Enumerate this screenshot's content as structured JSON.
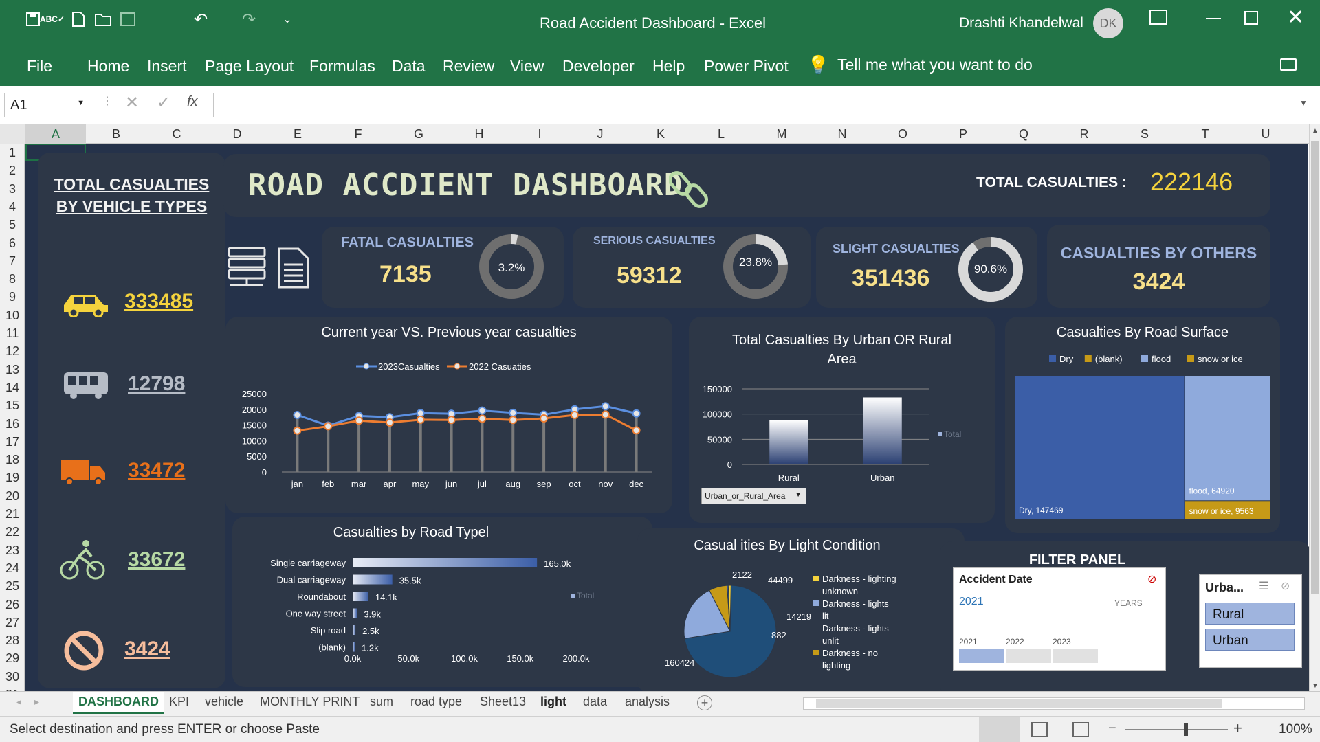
{
  "window": {
    "title": "Road Accident Dashboard  -  Excel",
    "user": "Drashti Khandelwal",
    "user_initials": "DK"
  },
  "menu": [
    "File",
    "Home",
    "Insert",
    "Page Layout",
    "Formulas",
    "Data",
    "Review",
    "View",
    "Developer",
    "Help",
    "Power Pivot"
  ],
  "tell_me": "Tell me what you want to do",
  "formula_bar": {
    "cell_ref": "A1",
    "fx": "fx",
    "value": ""
  },
  "columns": [
    "A",
    "B",
    "C",
    "D",
    "E",
    "F",
    "G",
    "H",
    "I",
    "J",
    "K",
    "L",
    "M",
    "N",
    "O",
    "P",
    "Q",
    "R",
    "S",
    "T",
    "U"
  ],
  "rows": [
    "1",
    "2",
    "3",
    "4",
    "5",
    "6",
    "7",
    "8",
    "9",
    "10",
    "11",
    "12",
    "13",
    "14",
    "15",
    "16",
    "17",
    "18",
    "19",
    "20",
    "21",
    "22",
    "23",
    "24",
    "25",
    "26",
    "27",
    "28",
    "29",
    "30",
    "31"
  ],
  "dashboard": {
    "title": "ROAD ACCDIENT DASHBOARD",
    "total_label": "TOTAL CASUALTIES :",
    "total_value": "222146",
    "vehicle_panel_title": "TOTAL CASUALTIES BY VEHICLE TYPES",
    "vehicles": [
      {
        "icon": "car-icon",
        "value": "333485",
        "color": "#f5d33d"
      },
      {
        "icon": "bus-icon",
        "value": "12798",
        "color": "#b6bcc6"
      },
      {
        "icon": "truck-icon",
        "value": "33472",
        "color": "#e8701a"
      },
      {
        "icon": "bicycle-icon",
        "value": "33672",
        "color": "#b7d9a4"
      },
      {
        "icon": "no-entry-icon",
        "value": "3424",
        "color": "#f6bd9c"
      }
    ],
    "kpis": [
      {
        "label": "FATAL CASUALTIES",
        "value": "7135",
        "pct": "3.2%",
        "frac": 0.032
      },
      {
        "label": "SERIOUS  CASUALTIES",
        "value": "59312",
        "pct": "23.8%",
        "frac": 0.238
      },
      {
        "label": "SLIGHT CASUALTIES",
        "value": "351436",
        "pct": "90.6%",
        "frac": 0.906
      }
    ],
    "others": {
      "label": "CASUALTIES BY OTHERS",
      "value": "3424"
    },
    "filter_panel": {
      "title": "FILTER PANEL",
      "timeline": {
        "title": "Accident Date",
        "year": "2021",
        "period": "YEARS",
        "years": [
          "2021",
          "2022",
          "2023"
        ]
      },
      "slicer": {
        "title": "Urba...",
        "items": [
          "Rural",
          "Urban"
        ]
      }
    }
  },
  "chart_data": [
    {
      "type": "line",
      "title": "Current year VS.  Previous year casualties",
      "categories": [
        "jan",
        "feb",
        "mar",
        "apr",
        "may",
        "jun",
        "jul",
        "aug",
        "sep",
        "oct",
        "nov",
        "dec"
      ],
      "series": [
        {
          "name": "2023Casualties",
          "color": "#5b8fe0",
          "values": [
            18200,
            14800,
            17900,
            17500,
            18800,
            18600,
            19600,
            18900,
            18300,
            20000,
            21000,
            18700
          ]
        },
        {
          "name": "2022 Casuaties",
          "color": "#ed7d31",
          "values": [
            13200,
            14600,
            16400,
            15800,
            16700,
            16600,
            17000,
            16600,
            17100,
            18200,
            18300,
            13300
          ]
        }
      ],
      "yticks": [
        "0",
        "5000",
        "10000",
        "15000",
        "20000",
        "25000"
      ],
      "ylim": [
        0,
        25000
      ],
      "grid": false
    },
    {
      "type": "bar",
      "title": "Total Casualties By Urban OR Rural Area",
      "categories": [
        "Rural",
        "Urban"
      ],
      "values": [
        88000,
        133000
      ],
      "yticks": [
        "0",
        "50000",
        "100000",
        "150000"
      ],
      "ylim": [
        0,
        150000
      ],
      "legend": "Total",
      "filter": "Urban_or_Rural_Area"
    },
    {
      "type": "treemap",
      "title": "Casualties By Road Surface",
      "legend": [
        {
          "name": "Dry",
          "color": "#3b5ea7"
        },
        {
          "name": "(blank)",
          "color": "#c69a17"
        },
        {
          "name": "flood",
          "color": "#8faadc"
        },
        {
          "name": "snow or ice",
          "color": "#c69a17"
        }
      ],
      "items": [
        {
          "label": "Dry, 147469",
          "value": 147469
        },
        {
          "label": "flood, 64920",
          "value": 64920
        },
        {
          "label": "snow or ice, 9563",
          "value": 9563
        }
      ]
    },
    {
      "type": "bar",
      "orientation": "horizontal",
      "title": "Casualties by Road Typel",
      "categories": [
        "Single carriageway",
        "Dual carriageway",
        "Roundabout",
        "One way street",
        "Slip road",
        "(blank)"
      ],
      "values": [
        165000,
        35500,
        14100,
        3900,
        2500,
        1200
      ],
      "labels": [
        "165.0k",
        "35.5k",
        "14.1k",
        "3.9k",
        "2.5k",
        "1.2k"
      ],
      "xticks": [
        "0.0k",
        "50.0k",
        "100.0k",
        "150.0k",
        "200.0k"
      ],
      "xlim": [
        0,
        200000
      ],
      "legend": "Total"
    },
    {
      "type": "pie",
      "title": "Casual ities By Light  Condition",
      "slices": [
        {
          "value": 160424,
          "label": "160424",
          "color": "#1f4e79"
        },
        {
          "value": 44499,
          "label": "44499",
          "color": "#8faadc"
        },
        {
          "value": 14219,
          "label": "14219",
          "color": "#c69a17"
        },
        {
          "value": 882,
          "label": "882",
          "color": "#4472c4"
        },
        {
          "value": 2122,
          "label": "2122",
          "color": "#f5d33d"
        }
      ],
      "legend": [
        "Darkness - lighting unknown",
        "Darkness - lights lit",
        "Darkness - lights unlit",
        "Darkness - no lighting"
      ]
    }
  ],
  "tabs": [
    "DASHBOARD",
    "KPI",
    "vehicle",
    "MONTHLY PRINT",
    "sum",
    "road type",
    "Sheet13",
    "light",
    "data",
    "analysis"
  ],
  "status": {
    "message": "Select destination and press ENTER or choose Paste",
    "zoom": "100%"
  }
}
